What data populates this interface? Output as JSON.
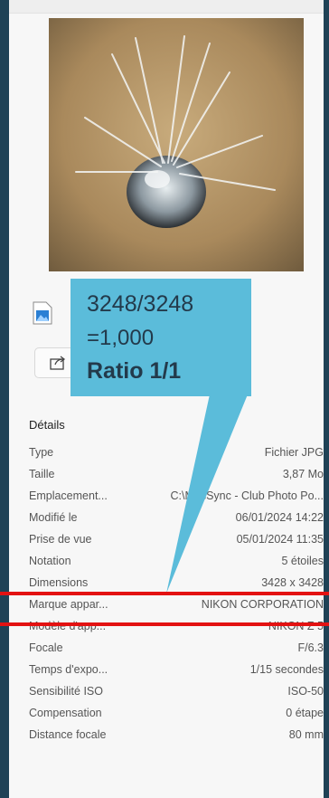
{
  "details": {
    "title": "Détails",
    "rows": [
      {
        "label": "Type",
        "value": "Fichier JPG"
      },
      {
        "label": "Taille",
        "value": "3,87 Mo"
      },
      {
        "label": "Emplacement...",
        "value": "C:\\MesSync - Club Photo Po..."
      },
      {
        "label": "Modifié le",
        "value": "06/01/2024 14:22"
      },
      {
        "label": "Prise de vue",
        "value": "05/01/2024 11:35"
      },
      {
        "label": "Notation",
        "value": "5 étoiles"
      },
      {
        "label": "Dimensions",
        "value": "3428 x 3428"
      },
      {
        "label": "Marque appar...",
        "value": "NIKON CORPORATION"
      },
      {
        "label": "Modèle d'app...",
        "value": "NIKON Z 5"
      },
      {
        "label": "Focale",
        "value": "F/6.3"
      },
      {
        "label": "Temps d'expo...",
        "value": "1/15 secondes"
      },
      {
        "label": "Sensibilité ISO",
        "value": "ISO-50"
      },
      {
        "label": "Compensation",
        "value": "0 étape"
      },
      {
        "label": "Distance focale",
        "value": "80 mm"
      }
    ]
  },
  "callout": {
    "line1": "3248/3248",
    "line2": "=1,000",
    "line3": "Ratio 1/1",
    "color": "#5bbcda"
  },
  "highlight_color": "#e31212",
  "icons": {
    "file": "image-file-icon",
    "share": "share-icon"
  }
}
